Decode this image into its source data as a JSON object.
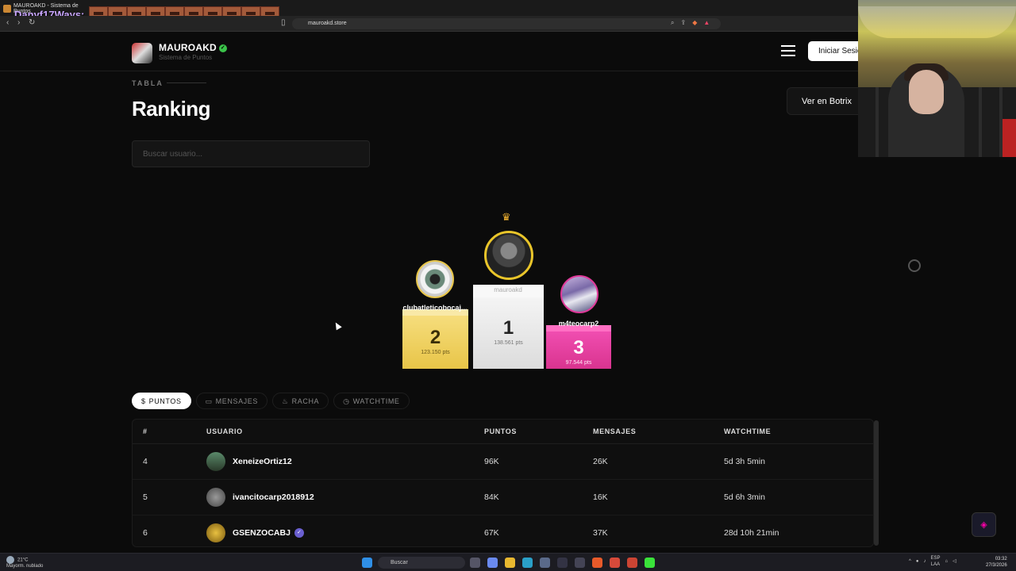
{
  "browser": {
    "tab_title": "MAUROAKD - Sistema de Puntos",
    "url": "mauroakd.store",
    "overlay_name": "Danyf17Ways:"
  },
  "header": {
    "brand": "MAUROAKD",
    "subtitle": "Sistema de Puntos",
    "login_label": "Iniciar Sesión"
  },
  "page": {
    "eyebrow": "TABLA",
    "title": "Ranking",
    "botrix_label": "Ver en Botrix",
    "search_placeholder": "Buscar usuario..."
  },
  "podium": {
    "first": {
      "rank": "1",
      "name": "mauroakd",
      "points": "138.561 pts"
    },
    "second": {
      "rank": "2",
      "name": "clubatleticobocaj...",
      "points": "123.150 pts"
    },
    "third": {
      "rank": "3",
      "name": "m4teocarp2",
      "points": "97.544 pts"
    }
  },
  "tabs": [
    {
      "icon": "$",
      "label": "PUNTOS"
    },
    {
      "icon": "▭",
      "label": "MENSAJES"
    },
    {
      "icon": "♨",
      "label": "RACHA"
    },
    {
      "icon": "◷",
      "label": "WATCHTIME"
    }
  ],
  "table": {
    "headers": {
      "rank": "#",
      "user": "USUARIO",
      "points": "PUNTOS",
      "messages": "MENSAJES",
      "watchtime": "WATCHTIME"
    },
    "rows": [
      {
        "rank": "4",
        "user": "XeneizeOrtiz12",
        "points": "96K",
        "messages": "26K",
        "watchtime": "5d 3h 5min",
        "verified": false
      },
      {
        "rank": "5",
        "user": "ivancitocarp2018912",
        "points": "84K",
        "messages": "16K",
        "watchtime": "5d 6h 3min",
        "verified": false
      },
      {
        "rank": "6",
        "user": "GSENZOCABJ",
        "points": "67K",
        "messages": "37K",
        "watchtime": "28d 10h 21min",
        "verified": true
      }
    ]
  },
  "taskbar": {
    "temperature": "21°C",
    "weather": "Mayorm. nublado",
    "search": "Buscar",
    "lang": "ESP",
    "lang2": "LAA",
    "time": "03:32",
    "date": "27/3/2026"
  },
  "colors": {
    "gold": "#e8c548",
    "silver": "#e6e6e6",
    "pink": "#e03a9a",
    "verified_green": "#3bc34a"
  }
}
